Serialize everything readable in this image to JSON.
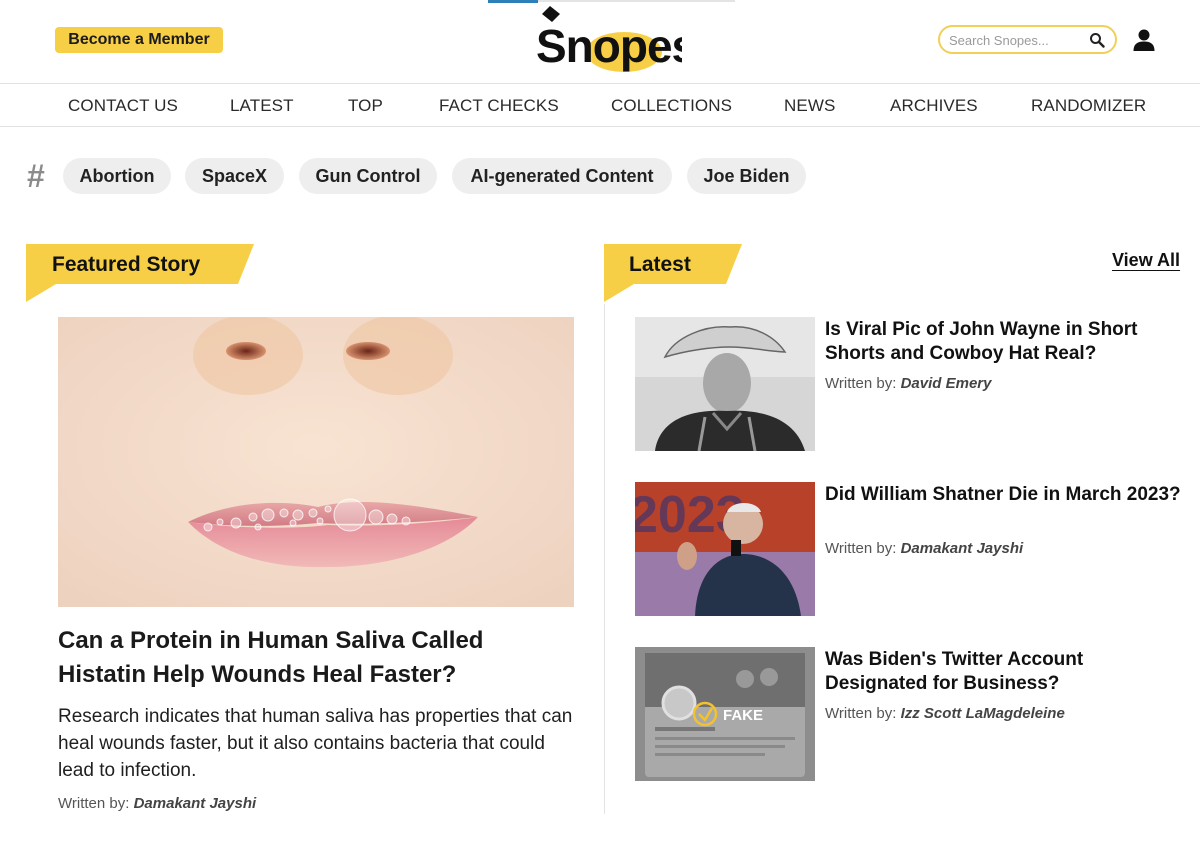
{
  "header": {
    "member_button": "Become a Member",
    "logo_text": "Snopes",
    "search_placeholder": "Search Snopes..."
  },
  "nav": {
    "items": [
      "CONTACT US",
      "LATEST",
      "TOP",
      "FACT CHECKS",
      "COLLECTIONS",
      "NEWS",
      "ARCHIVES",
      "RANDOMIZER"
    ]
  },
  "tags": {
    "items": [
      "Abortion",
      "SpaceX",
      "Gun Control",
      "AI-generated Content",
      "Joe Biden"
    ]
  },
  "featured": {
    "heading": "Featured Story",
    "title": "Can a Protein in Human Saliva Called Histatin Help Wounds Heal Faster?",
    "description": "Research indicates that human saliva has properties that can heal wounds faster, but it also contains bacteria that could lead to infection.",
    "byline_label": "Written by:",
    "author": "Damakant Jayshi"
  },
  "latest": {
    "heading": "Latest",
    "view_all": "View All",
    "items": [
      {
        "title": "Is Viral Pic of John Wayne in Short Shorts and Cowboy Hat Real?",
        "byline_label": "Written by:",
        "author": "David Emery"
      },
      {
        "title": "Did William Shatner Die in March 2023?",
        "byline_label": "Written by:",
        "author": "Damakant Jayshi",
        "thumb_text": "2023"
      },
      {
        "title": "Was Biden's Twitter Account Designated for Business?",
        "byline_label": "Written by:",
        "author": "Izz Scott LaMagdeleine",
        "thumb_badge": "FAKE"
      }
    ]
  },
  "colors": {
    "brand_yellow": "#f7cf46",
    "text": "#111111",
    "nav_border": "#e2e2e2"
  }
}
